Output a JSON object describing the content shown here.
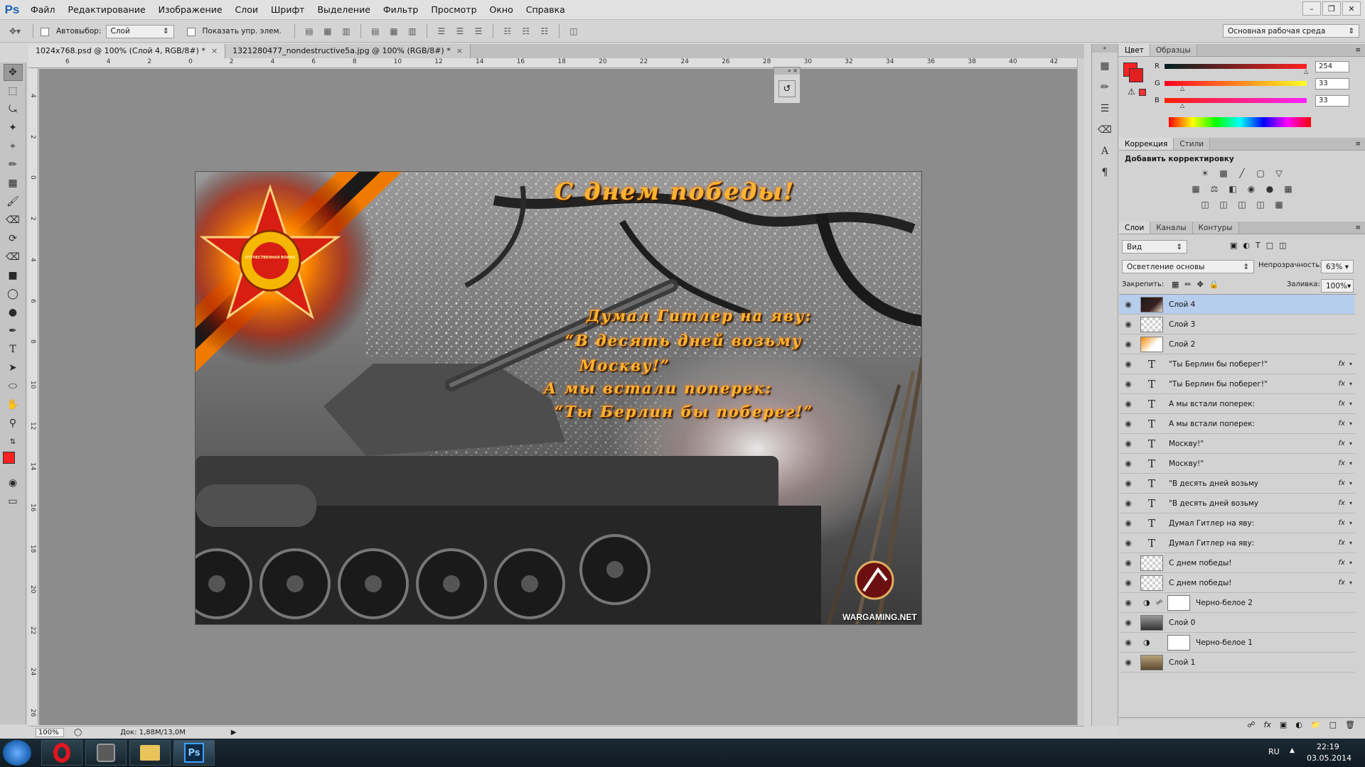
{
  "menu": {
    "logo": "Ps",
    "items": [
      "Файл",
      "Редактирование",
      "Изображение",
      "Слои",
      "Шрифт",
      "Выделение",
      "Фильтр",
      "Просмотр",
      "Окно",
      "Справка"
    ]
  },
  "options": {
    "autoselect_label": "Автовыбор:",
    "autoselect_value": "Слой",
    "show_transform_label": "Показать упр. элем.",
    "workspace": "Основная рабочая среда"
  },
  "tabs": [
    {
      "label": "1024x768.psd @ 100% (Слой 4, RGB/8#) *"
    },
    {
      "label": "1321280477_nondestructive5a.jpg @ 100% (RGB/8#) *"
    }
  ],
  "ruler_top": [
    "6",
    "4",
    "2",
    "0",
    "2",
    "4",
    "6",
    "8",
    "10",
    "12",
    "14",
    "16",
    "18",
    "20",
    "22",
    "24",
    "26",
    "28",
    "30",
    "32",
    "34",
    "36",
    "38",
    "40",
    "42"
  ],
  "ruler_left": [
    "4",
    "2",
    "0",
    "2",
    "4",
    "6",
    "8",
    "10",
    "12",
    "14",
    "16",
    "18",
    "20",
    "22",
    "24",
    "26"
  ],
  "status": {
    "zoom": "100%",
    "doc": "Док: 1,88M/13,0M"
  },
  "artwork": {
    "title": "С днем победы!",
    "lines": [
      "Думал Гитлер на яву:",
      "“В десять дней возьму",
      "Москву!”",
      "А мы встали поперек:",
      "“Ты Берлин бы поберег!”"
    ],
    "logo_text": "WARGAMING.NET",
    "star_text": "ОТЕЧЕСТВЕННАЯ ВОЙНА"
  },
  "color_panel": {
    "tabs": [
      "Цвет",
      "Образцы"
    ],
    "r_label": "R",
    "g_label": "G",
    "b_label": "B",
    "r": "254",
    "g": "33",
    "b": "33",
    "fg_color": "#fe2121"
  },
  "correction_panel": {
    "tabs": [
      "Коррекция",
      "Стили"
    ],
    "heading": "Добавить корректировку"
  },
  "layers_panel": {
    "tabs": [
      "Слои",
      "Каналы",
      "Контуры"
    ],
    "filter": "Вид",
    "blend_mode": "Осветление основы",
    "opacity_label": "Непрозрачность:",
    "opacity": "63%",
    "lock_label": "Закрепить:",
    "fill_label": "Заливка:",
    "fill": "100%",
    "layers": [
      {
        "name": "Слой 4",
        "kind": "image-dark",
        "fx": false,
        "selected": true
      },
      {
        "name": "Слой 3",
        "kind": "empty",
        "fx": false,
        "selected": false
      },
      {
        "name": "Слой 2",
        "kind": "image-star",
        "fx": false,
        "selected": false
      },
      {
        "name": "\"Ты Берлин бы поберег!\"",
        "kind": "text",
        "fx": true,
        "selected": false
      },
      {
        "name": "\"Ты Берлин бы поберег!\"",
        "kind": "text",
        "fx": true,
        "selected": false
      },
      {
        "name": "А мы встали поперек:",
        "kind": "text",
        "fx": true,
        "selected": false
      },
      {
        "name": "А мы встали поперек:",
        "kind": "text",
        "fx": true,
        "selected": false
      },
      {
        "name": "Москву!\"",
        "kind": "text",
        "fx": true,
        "selected": false
      },
      {
        "name": "Москву!\"",
        "kind": "text",
        "fx": true,
        "selected": false
      },
      {
        "name": "\"В десять дней возьму",
        "kind": "text",
        "fx": true,
        "selected": false
      },
      {
        "name": "\"В десять дней возьму",
        "kind": "text",
        "fx": true,
        "selected": false
      },
      {
        "name": "Думал Гитлер на яву:",
        "kind": "text",
        "fx": true,
        "selected": false
      },
      {
        "name": "Думал Гитлер на яву:",
        "kind": "text",
        "fx": true,
        "selected": false
      },
      {
        "name": "С днем победы!",
        "kind": "empty",
        "fx": true,
        "selected": false
      },
      {
        "name": "С днем победы!",
        "kind": "empty",
        "fx": true,
        "selected": false
      },
      {
        "name": "Черно-белое 2",
        "kind": "adjust-link",
        "fx": false,
        "selected": false
      },
      {
        "name": "Слой 0",
        "kind": "image-tank",
        "fx": false,
        "selected": false
      },
      {
        "name": "Черно-белое 1",
        "kind": "adjust",
        "fx": false,
        "selected": false
      },
      {
        "name": "Слой 1",
        "kind": "image-photo",
        "fx": false,
        "selected": false
      }
    ]
  },
  "taskbar": {
    "lang": "RU",
    "time": "22:19",
    "date": "03.05.2014",
    "ps_label": "Ps"
  }
}
